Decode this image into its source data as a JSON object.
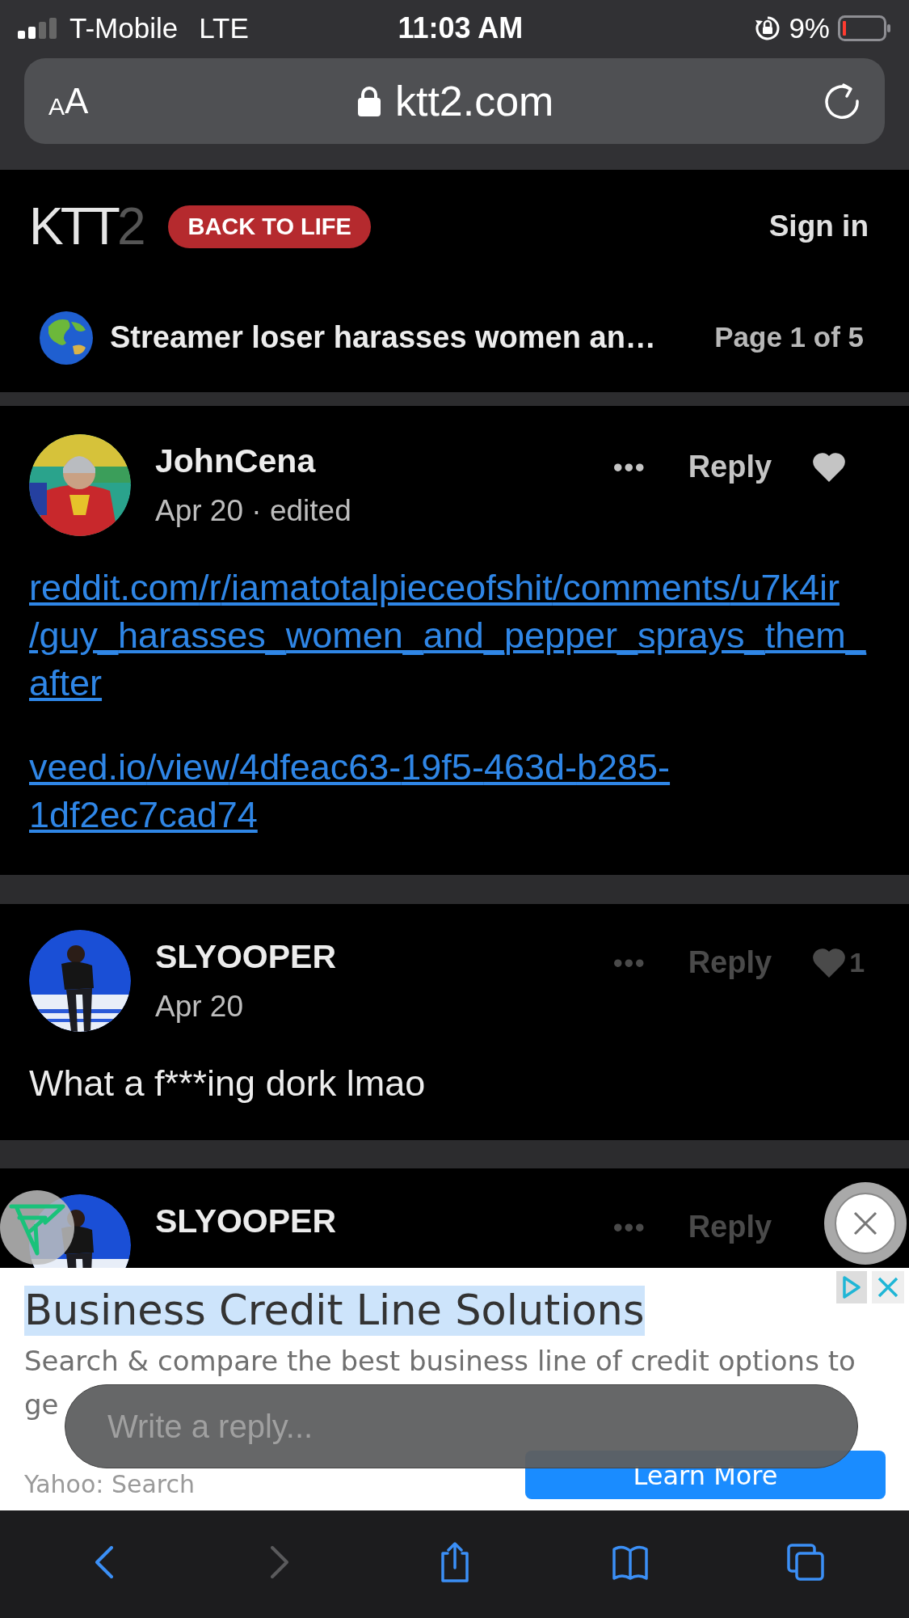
{
  "status_bar": {
    "carrier": "T-Mobile",
    "network": "LTE",
    "time": "11:03 AM",
    "battery": "9%"
  },
  "browser": {
    "text_size": "AA",
    "url": "ktt2.com"
  },
  "site_header": {
    "logo": "KTT2",
    "badge": "BACK TO LIFE",
    "sign_in": "Sign in"
  },
  "thread": {
    "title": "Streamer loser harasses women an…",
    "pages": "Page 1 of 5"
  },
  "posts": [
    {
      "author": "JohnCena",
      "date": "Apr 20 · edited",
      "actions_dimmed": false,
      "actions": [
        {
          "kind": "more",
          "label": "•••"
        },
        {
          "kind": "reply",
          "label": "Reply"
        },
        {
          "kind": "heart"
        }
      ],
      "body": [
        {
          "kind": "link",
          "text": "reddit.com/r/iamatotalpieceofshit/comments/u7k4ir/guy_harasses_women_and_pepper_sprays_them_after"
        },
        {
          "kind": "link",
          "text": "veed.io/view/4dfeac63-19f5-463d-b285-1df2ec7cad74"
        }
      ]
    },
    {
      "author": "SLYOOPER",
      "date": "Apr 20",
      "actions_dimmed": true,
      "actions": [
        {
          "kind": "more",
          "label": "•••"
        },
        {
          "kind": "reply",
          "label": "Reply"
        },
        {
          "kind": "heart"
        },
        {
          "kind": "count",
          "label": "1"
        }
      ],
      "body": [
        {
          "kind": "text",
          "text": "What a f***ing dork lmao"
        }
      ]
    },
    {
      "author": "SLYOOPER",
      "actions_dimmed": true,
      "actions": [
        {
          "kind": "more",
          "label": "•••"
        },
        {
          "kind": "reply",
          "label": "Reply"
        }
      ]
    }
  ],
  "ad": {
    "title": "Business Credit Line Solutions",
    "description_lines": [
      "Search & compare the best business line of credit options to",
      "ge"
    ],
    "source": "Yahoo: Search",
    "button": "Learn More"
  },
  "reply_field": {
    "placeholder": "Write a reply..."
  },
  "toolbar": [
    {
      "kind": "back",
      "disabled": false
    },
    {
      "kind": "forward",
      "disabled": true
    },
    {
      "kind": "share",
      "disabled": false
    },
    {
      "kind": "bookmarks",
      "disabled": false
    },
    {
      "kind": "tabs",
      "disabled": false
    }
  ]
}
